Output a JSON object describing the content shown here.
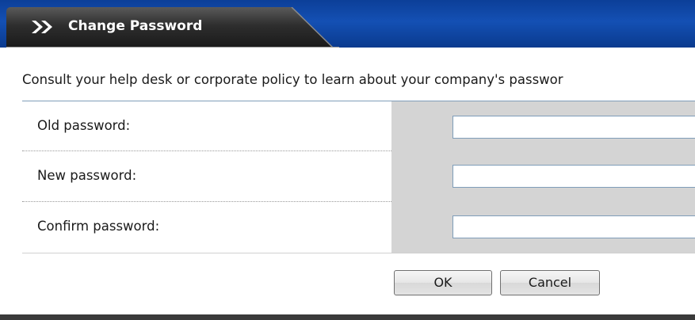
{
  "dialog": {
    "title": "Change Password",
    "title_icon": "double-chevron-right-icon",
    "intro_text": "Consult your help desk or corporate policy to learn about your company's passwor"
  },
  "form": {
    "fields": [
      {
        "label": "Old password:",
        "value": "",
        "type": "password"
      },
      {
        "label": "New password:",
        "value": "",
        "type": "password"
      },
      {
        "label": "Confirm password:",
        "value": "",
        "type": "password"
      }
    ]
  },
  "buttons": {
    "ok_label": "OK",
    "cancel_label": "Cancel"
  },
  "colors": {
    "title_bar_blue": "#1450b4",
    "title_tab_dark": "#2b2b2b",
    "field_column_grey": "#d4d4d4",
    "input_border": "#7f9db9"
  }
}
